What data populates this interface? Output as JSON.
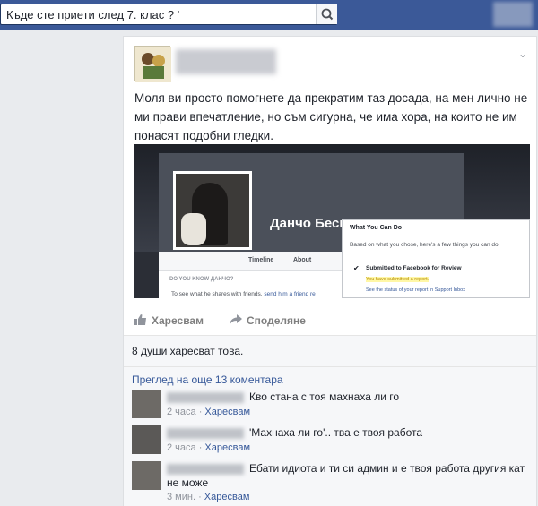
{
  "search": {
    "query": "Къде сте приети след 7. клас ? '"
  },
  "post": {
    "text": "Моля ви просто помогнете да прекратим таз досада, на мен лично не ми прави впечатление, но съм сигурна, че има хора, на които не им понасят подобни гледки.",
    "screenshot": {
      "profile_name": "Данчо Бесило",
      "tabs": [
        "Timeline",
        "About"
      ],
      "dyk_title": "DO YOU KNOW ДАНЧО?",
      "dyk_text": "To see what he shares with friends,",
      "dyk_link": "send him a friend re",
      "popup": {
        "title": "What You Can Do",
        "desc": "Based on what you chose, here's a few things you can do.",
        "check": "✔",
        "submitted": "Submitted to Facebook for Review",
        "highlight": "You have submitted a report.",
        "link": "See the status of your report in Support Inbox"
      }
    }
  },
  "actions": {
    "like": "Харесвам",
    "share": "Споделяне"
  },
  "feedback": {
    "likes": "8 души харесват това.",
    "more_comments": "Преглед на още 13 коментара"
  },
  "comments": [
    {
      "text": "Кво стана с тоя махнаха ли го",
      "time": "2 часа",
      "like": "Харесвам"
    },
    {
      "text": "'Махнаха ли го'.. тва е твоя работа",
      "time": "2 часа",
      "like": "Харесвам"
    },
    {
      "text": "Ебати идиота и ти си админ и е твоя работа другия кат не може",
      "time": "3 мин.",
      "like": "Харесвам"
    }
  ],
  "icons": {
    "search": "search-icon",
    "like": "thumbs-up-icon",
    "share": "share-arrow-icon",
    "menu": "chevron-down-icon"
  },
  "colors": {
    "topbar": "#3b5998",
    "link": "#365899",
    "meta": "#90949c"
  }
}
